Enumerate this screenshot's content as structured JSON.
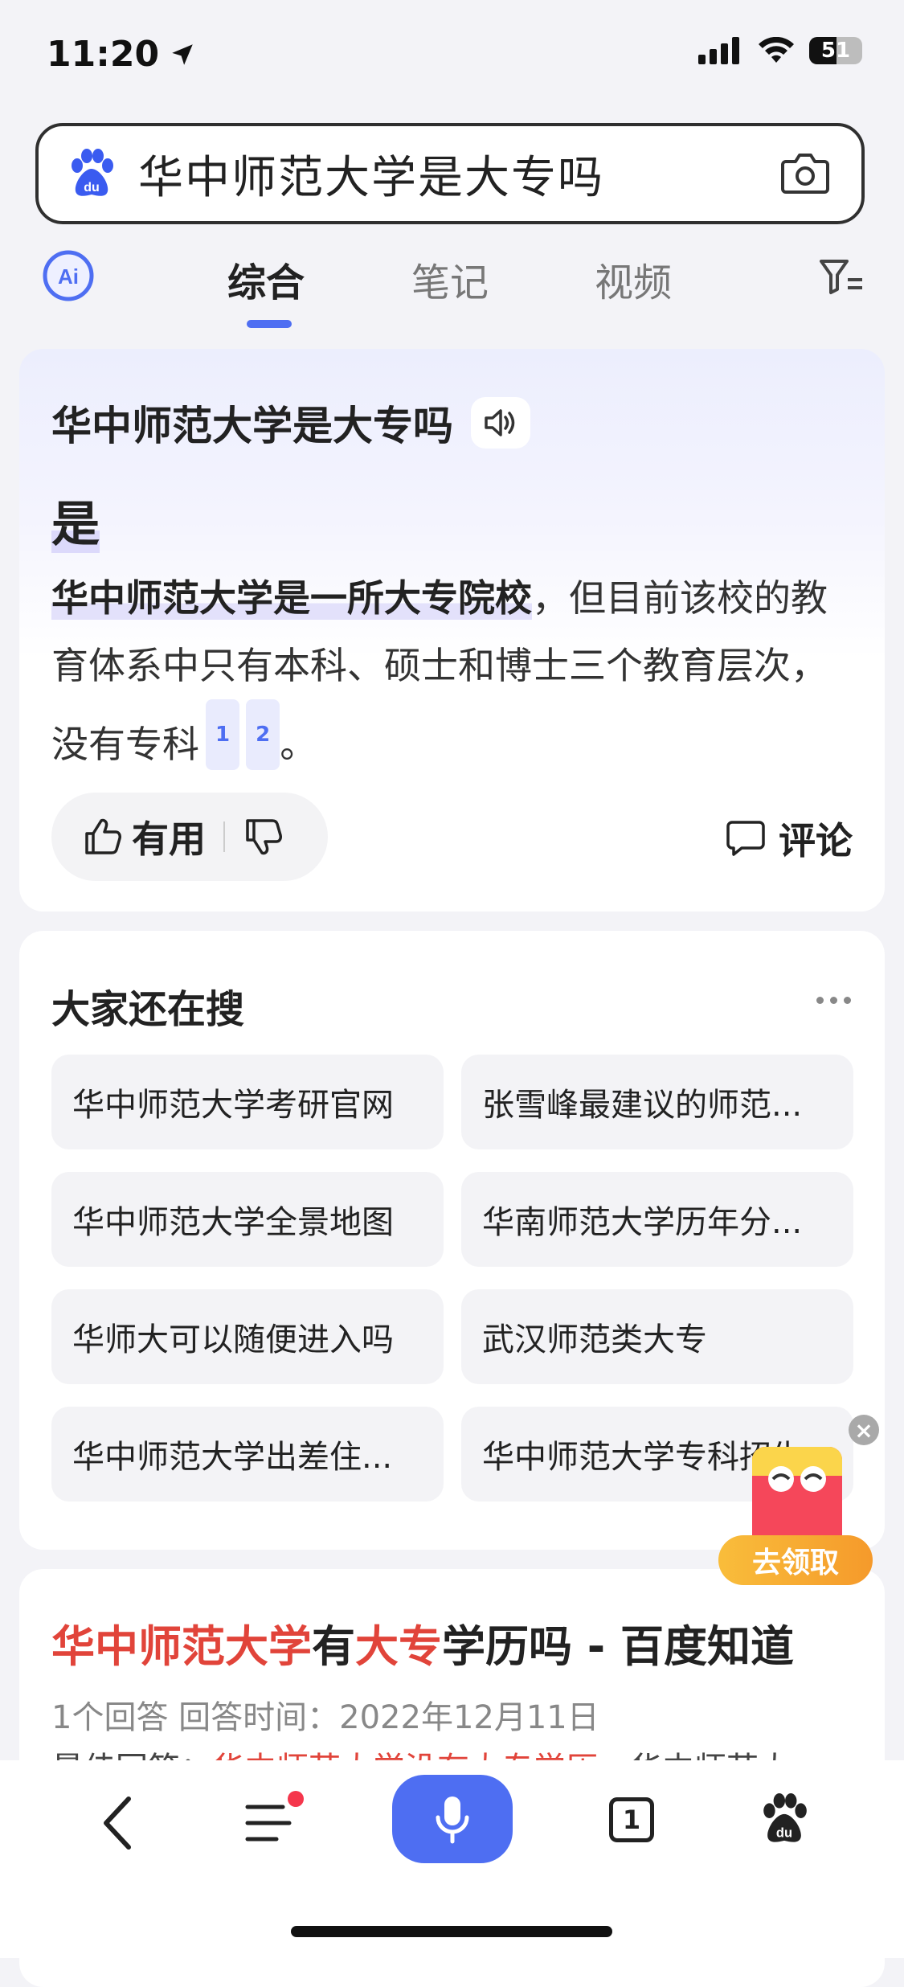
{
  "status_bar": {
    "time": "11:20",
    "battery": "51"
  },
  "search": {
    "query": "华中师范大学是大专吗"
  },
  "tabs": [
    {
      "label": "综合"
    },
    {
      "label": "笔记"
    },
    {
      "label": "视频"
    }
  ],
  "ai_card": {
    "question": "华中师范大学是大专吗",
    "answer": "是",
    "desc_highlight": "华中师范大学是一所大专院校",
    "desc_rest": "，但目前该校的教育体系中只有本科、硕士和博士三个教育层次，没有专科",
    "citations": [
      "1",
      "2"
    ],
    "period": "。",
    "useful_label": "有用",
    "comment_label": "评论"
  },
  "related": {
    "title": "大家还在搜",
    "items": [
      "华中师范大学考研官网",
      "张雪峰最建议的师范...",
      "华中师范大学全景地图",
      "华南师范大学历年分...",
      "华师大可以随便进入吗",
      "武汉师范类大专",
      "华中师范大学出差住...",
      "华中师范大学专科招生"
    ]
  },
  "result": {
    "title_parts": [
      "华中师范大学",
      "有",
      "大专",
      "学历吗 - 百度知道"
    ],
    "meta": "1个回答   回答时间：2022年12月11日",
    "snippet_prefix": "最佳回答：",
    "snippet_red": "华中师范大学没有大专学历",
    "snippet_rest": "，华中师范大"
  },
  "promo": {
    "label": "去领取"
  },
  "bottom_nav": {
    "tab_count": "1"
  },
  "colors": {
    "accent": "#4e6ef2",
    "highlight_red": "#e1443a"
  }
}
